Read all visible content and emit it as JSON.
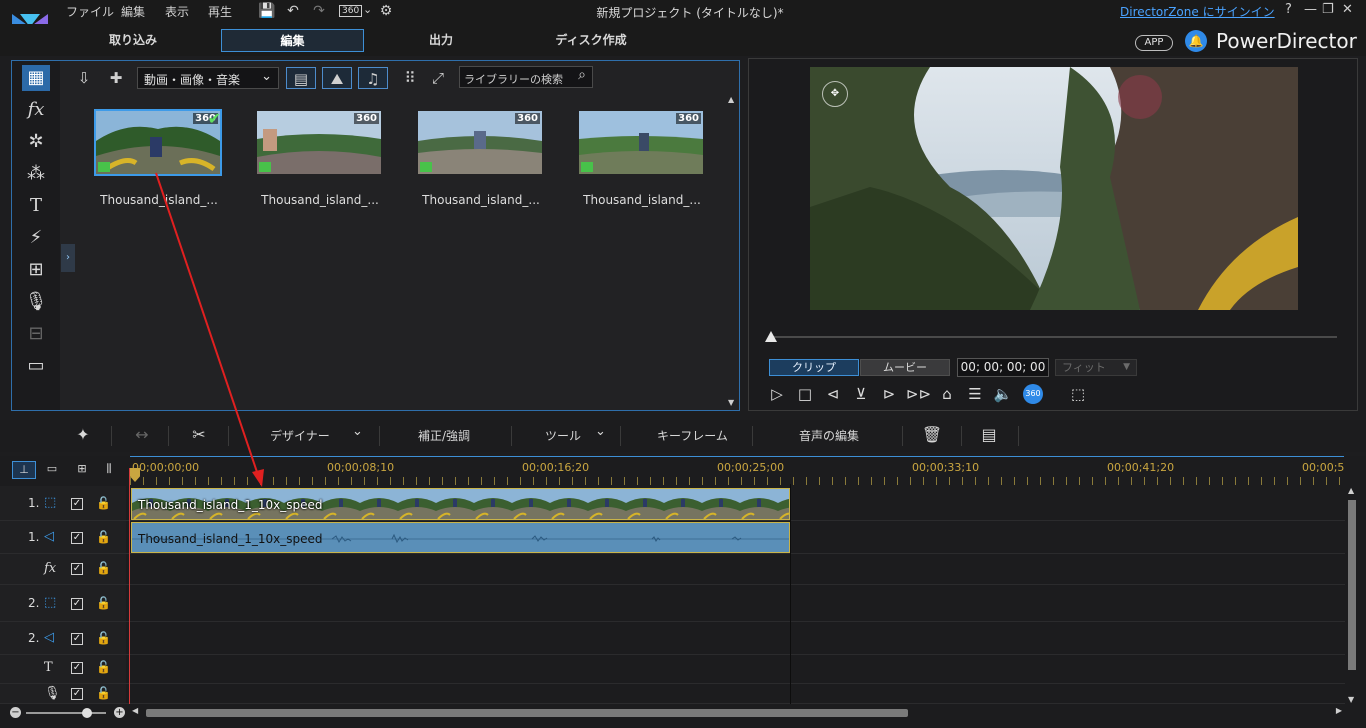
{
  "menu": {
    "file": "ファイル",
    "edit": "編集",
    "view": "表示",
    "play": "再生"
  },
  "title_bar": {
    "window_title": "新規プロジェクト (タイトルなし)*",
    "directorzone_link": "DirectorZone にサインイン",
    "badge_360": "360",
    "help": "?"
  },
  "mode_tabs": [
    {
      "label": "取り込み"
    },
    {
      "label": "編集",
      "active": true
    },
    {
      "label": "出力"
    },
    {
      "label": "ディスク作成"
    }
  ],
  "brand": {
    "app_badge": "APP",
    "name": "PowerDirector",
    "accent": "#2f8ae8"
  },
  "library": {
    "filter_select": "動画・画像・音楽",
    "search_placeholder": "ライブラリーの検索",
    "items": [
      {
        "caption": "Thousand_island_...",
        "badge": "360",
        "selected": true
      },
      {
        "caption": "Thousand_island_...",
        "badge": "360",
        "selected": false
      },
      {
        "caption": "Thousand_island_...",
        "badge": "360",
        "selected": false
      },
      {
        "caption": "Thousand_island_...",
        "badge": "360",
        "selected": false
      }
    ],
    "side_items": [
      "media-room-icon",
      "fx-icon",
      "particle-icon",
      "pip-icon",
      "title-icon",
      "transition-icon",
      "subtitle-frame-icon",
      "microphone-icon",
      "chapter-icon",
      "subtitle-icon"
    ],
    "side_fx": "fx",
    "side_title": "T"
  },
  "preview": {
    "clip_toggle": "クリップ",
    "movie_toggle": "ムービー",
    "timecode": "00; 00; 00; 00",
    "fit_select": "フィット",
    "badge_360": "360"
  },
  "edit_toolbar": {
    "designer": "デザイナー",
    "correct": "補正/強調",
    "tools": "ツール",
    "keyframe": "キーフレーム",
    "audio_edit": "音声の編集"
  },
  "timeline": {
    "ruler_labels": [
      "00;00;00;00",
      "00;00;08;10",
      "00;00;16;20",
      "00;00;25;00",
      "00;00;33;10",
      "00;00;41;20",
      "00;00;5"
    ],
    "tracks": [
      {
        "num": "1.",
        "type": "video"
      },
      {
        "num": "1.",
        "type": "audio"
      },
      {
        "num": "",
        "type": "fx",
        "label": "fx"
      },
      {
        "num": "2.",
        "type": "video"
      },
      {
        "num": "2.",
        "type": "audio"
      },
      {
        "num": "",
        "type": "title",
        "label": "T"
      },
      {
        "num": "",
        "type": "voice"
      }
    ],
    "video_clip_name": "Thousand_island_1_10x_speed",
    "audio_clip_name": "Thousand_island_1_10x_speed",
    "playhead_color": "#d63a3a"
  }
}
